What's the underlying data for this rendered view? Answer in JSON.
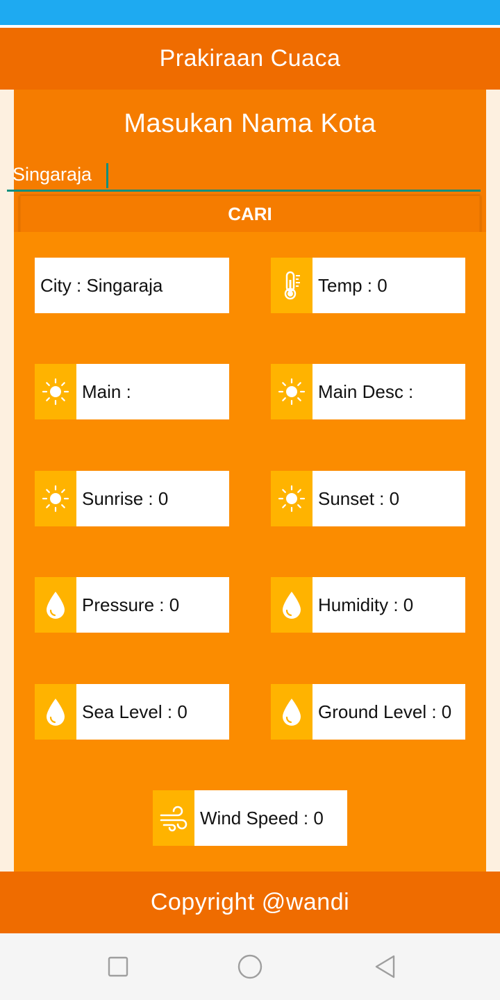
{
  "app_bar": {
    "title": "Prakiraan Cuaca"
  },
  "search": {
    "prompt": "Masukan Nama Kota",
    "city_value": "Singaraja",
    "button_label": "CARI"
  },
  "cards": {
    "city": {
      "label": "City : Singaraja"
    },
    "temp": {
      "label": "Temp : 0",
      "icon": "thermometer-icon"
    },
    "main": {
      "label": "Main :",
      "icon": "sun-icon"
    },
    "main_desc": {
      "label": "Main Desc :",
      "icon": "sun-icon"
    },
    "sunrise": {
      "label": "Sunrise : 0",
      "icon": "sun-icon"
    },
    "sunset": {
      "label": "Sunset : 0",
      "icon": "sun-icon"
    },
    "pressure": {
      "label": "Pressure : 0",
      "icon": "water-drop-icon"
    },
    "humidity": {
      "label": "Humidity : 0",
      "icon": "water-drop-icon"
    },
    "sea_level": {
      "label": "Sea Level : 0",
      "icon": "water-drop-icon"
    },
    "ground_level": {
      "label": "Ground Level : 0",
      "icon": "water-drop-icon"
    },
    "wind_speed": {
      "label": "Wind Speed : 0",
      "icon": "wind-icon"
    }
  },
  "footer": {
    "text": "Copyright @wandi"
  },
  "colors": {
    "status_bar": "#1eaaf1",
    "app_bar": "#ef6c00",
    "search_panel": "#f57c00",
    "info_panel": "#fb8c00",
    "icon_bg": "#ffb300",
    "accent": "#0e8f7e"
  }
}
